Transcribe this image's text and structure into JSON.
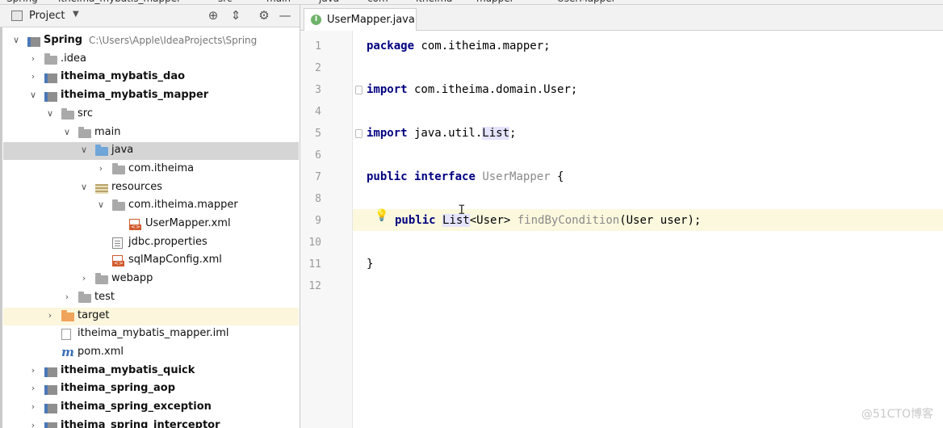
{
  "breadcrumb": [
    "Spring",
    "itheima_mybatis_mapper",
    "src",
    "main",
    "java",
    "com",
    "itheima",
    "mapper",
    "UserMapper"
  ],
  "project_pane": {
    "title": "Project",
    "tree": [
      {
        "label": "Spring",
        "path": "C:\\Users\\Apple\\IdeaProjects\\Spring",
        "icon": "module-icon",
        "arrow": "expanded",
        "bold": true
      },
      {
        "label": ".idea",
        "icon": "folder-icon",
        "arrow": "collapsed",
        "bold": false
      },
      {
        "label": "itheima_mybatis_dao",
        "icon": "module-icon",
        "arrow": "collapsed",
        "bold": true
      },
      {
        "label": "itheima_mybatis_mapper",
        "icon": "module-icon",
        "arrow": "expanded",
        "bold": true
      },
      {
        "label": "src",
        "icon": "folder-icon",
        "arrow": "expanded",
        "bold": false
      },
      {
        "label": "main",
        "icon": "folder-icon",
        "arrow": "expanded",
        "bold": false
      },
      {
        "label": "java",
        "icon": "source-folder-icon",
        "arrow": "expanded",
        "bold": false,
        "selected": true
      },
      {
        "label": "com.itheima",
        "icon": "package-icon",
        "arrow": "collapsed",
        "bold": false
      },
      {
        "label": "resources",
        "icon": "resources-folder-icon",
        "arrow": "expanded",
        "bold": false
      },
      {
        "label": "com.itheima.mapper",
        "icon": "package-icon",
        "arrow": "expanded",
        "bold": false
      },
      {
        "label": "UserMapper.xml",
        "icon": "xml-file-icon",
        "arrow": "none",
        "bold": false
      },
      {
        "label": "jdbc.properties",
        "icon": "properties-file-icon",
        "arrow": "none",
        "bold": false
      },
      {
        "label": "sqlMapConfig.xml",
        "icon": "xml-file-icon",
        "arrow": "none",
        "bold": false
      },
      {
        "label": "webapp",
        "icon": "folder-icon",
        "arrow": "collapsed",
        "bold": false
      },
      {
        "label": "test",
        "icon": "folder-icon",
        "arrow": "collapsed",
        "bold": false
      },
      {
        "label": "target",
        "icon": "excluded-folder-icon",
        "arrow": "collapsed",
        "bold": false,
        "excluded": true
      },
      {
        "label": "itheima_mybatis_mapper.iml",
        "icon": "iml-file-icon",
        "arrow": "none",
        "bold": false
      },
      {
        "label": "pom.xml",
        "icon": "maven-icon",
        "arrow": "none",
        "bold": false
      },
      {
        "label": "itheima_mybatis_quick",
        "icon": "module-icon",
        "arrow": "collapsed",
        "bold": true
      },
      {
        "label": "itheima_spring_aop",
        "icon": "module-icon",
        "arrow": "collapsed",
        "bold": true
      },
      {
        "label": "itheima_spring_exception",
        "icon": "module-icon",
        "arrow": "collapsed",
        "bold": true
      },
      {
        "label": "itheima_spring_interceptor",
        "icon": "module-icon",
        "arrow": "collapsed",
        "bold": true
      }
    ]
  },
  "editor": {
    "tab": {
      "label": "UserMapper.java",
      "icon": "interface-icon",
      "icon_letter": "I"
    },
    "line_numbers": [
      "1",
      "2",
      "3",
      "4",
      "5",
      "6",
      "7",
      "8",
      "9",
      "10",
      "11",
      "12"
    ],
    "code": {
      "l1_kw": "package",
      "l1_rest": " com.itheima.mapper;",
      "l3_kw": "import",
      "l3_rest": " com.itheima.domain.User;",
      "l5_kw": "import",
      "l5_rest": " java.util.",
      "l5_hl": "List",
      "l5_end": ";",
      "l7_kw1": "public",
      "l7_kw2": "interface",
      "l7_name": "UserMapper",
      "l7_end": " {",
      "l9_kw": "public",
      "l9_type": "List",
      "l9_gen": "<User>",
      "l9_method": "findByCondition",
      "l9_params": "(User user);",
      "l11": "}"
    }
  },
  "watermark": "@51CTO博客",
  "colors": {
    "keyword": "#000080",
    "caret_line": "#fbf8de",
    "selection": "#d5d5d5"
  }
}
